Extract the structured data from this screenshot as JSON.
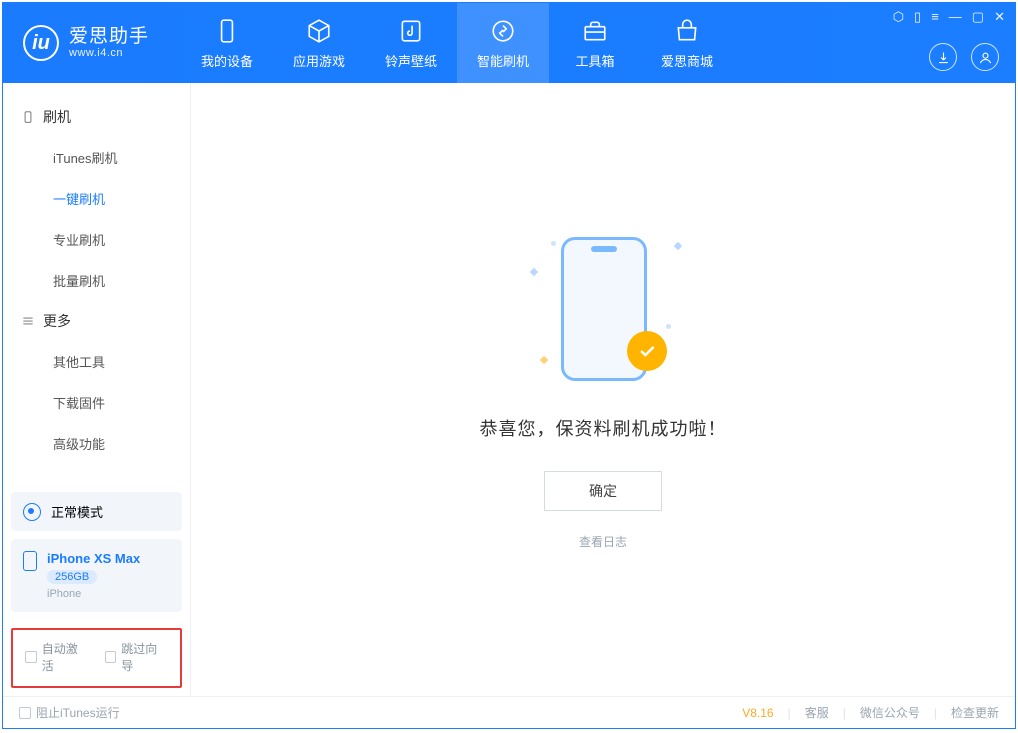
{
  "app": {
    "logo_title": "爱思助手",
    "logo_subtitle": "www.i4.cn"
  },
  "tabs": [
    {
      "label": "我的设备",
      "icon": "device"
    },
    {
      "label": "应用游戏",
      "icon": "cube"
    },
    {
      "label": "铃声壁纸",
      "icon": "music"
    },
    {
      "label": "智能刷机",
      "icon": "recycle",
      "active": true
    },
    {
      "label": "工具箱",
      "icon": "toolbox"
    },
    {
      "label": "爱思商城",
      "icon": "store"
    }
  ],
  "sidebar": {
    "group1_title": "刷机",
    "group1_items": [
      "iTunes刷机",
      "一键刷机",
      "专业刷机",
      "批量刷机"
    ],
    "group1_active_index": 1,
    "group2_title": "更多",
    "group2_items": [
      "其他工具",
      "下载固件",
      "高级功能"
    ]
  },
  "device": {
    "mode_label": "正常模式",
    "name": "iPhone XS Max",
    "storage": "256GB",
    "type": "iPhone"
  },
  "checks": {
    "auto_activate": "自动激活",
    "skip_guide": "跳过向导"
  },
  "main": {
    "success_msg": "恭喜您，保资料刷机成功啦！",
    "ok_btn": "确定",
    "view_log": "查看日志"
  },
  "statusbar": {
    "block_itunes": "阻止iTunes运行",
    "version": "V8.16",
    "support": "客服",
    "wechat": "微信公众号",
    "check_update": "检查更新"
  }
}
